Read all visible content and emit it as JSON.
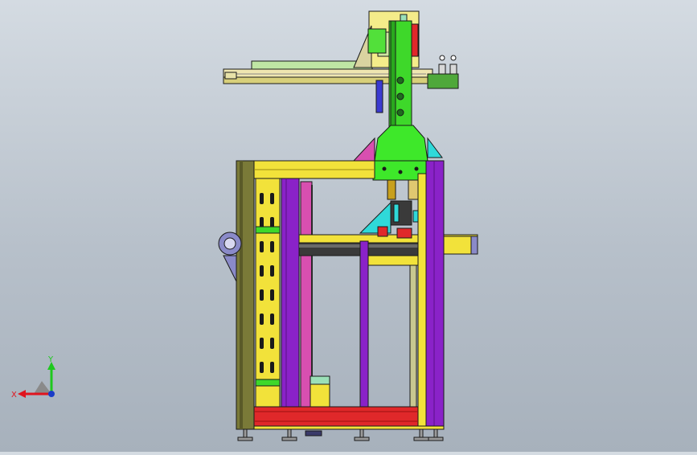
{
  "viewport": {
    "background_top": "#d4dbe2",
    "background_bottom": "#a7b1bc",
    "scene": "cad-gantry-assembly"
  },
  "triad": {
    "x_label": "X",
    "y_label": "Y",
    "x_color": "#e0141e",
    "y_color": "#1ec81e",
    "z_color": "#1a3cc8"
  },
  "colors": {
    "frame_olive": "#6f6e33",
    "purple": "#8a22c8",
    "yellow": "#f2e23a",
    "green": "#33e01e",
    "red": "#e0282a",
    "cyan": "#2fd9d9",
    "magenta": "#d84fb0",
    "outline": "#1a1a1a"
  }
}
